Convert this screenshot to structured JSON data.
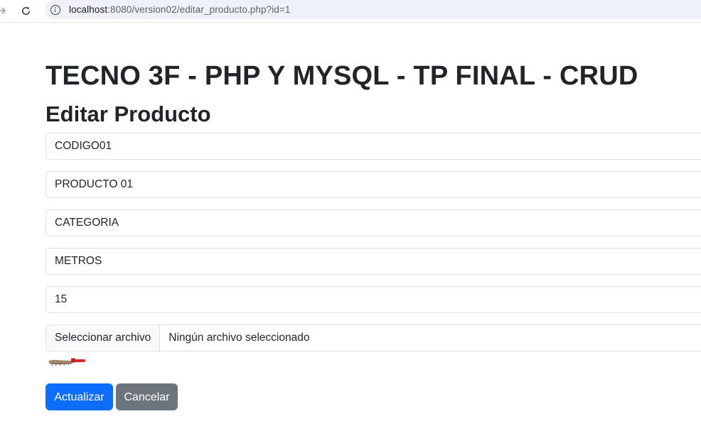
{
  "browser": {
    "url_host": "localhost",
    "url_rest": ":8080/version02/editar_producto.php?id=1"
  },
  "page": {
    "title": "TECNO 3F - PHP Y MYSQL - TP FINAL - CRUD",
    "subtitle": "Editar Producto"
  },
  "form": {
    "codigo": "CODIGO01",
    "producto": "PRODUCTO 01",
    "categoria": "CATEGORIA",
    "unidad": "METROS",
    "cantidad": "15",
    "file_button_label": "Seleccionar archivo",
    "file_status": "Ningún archivo seleccionado"
  },
  "buttons": {
    "update_label": "Actualizar",
    "cancel_label": "Cancelar"
  },
  "colors": {
    "primary": "#0d6efd",
    "secondary": "#6c757d"
  }
}
